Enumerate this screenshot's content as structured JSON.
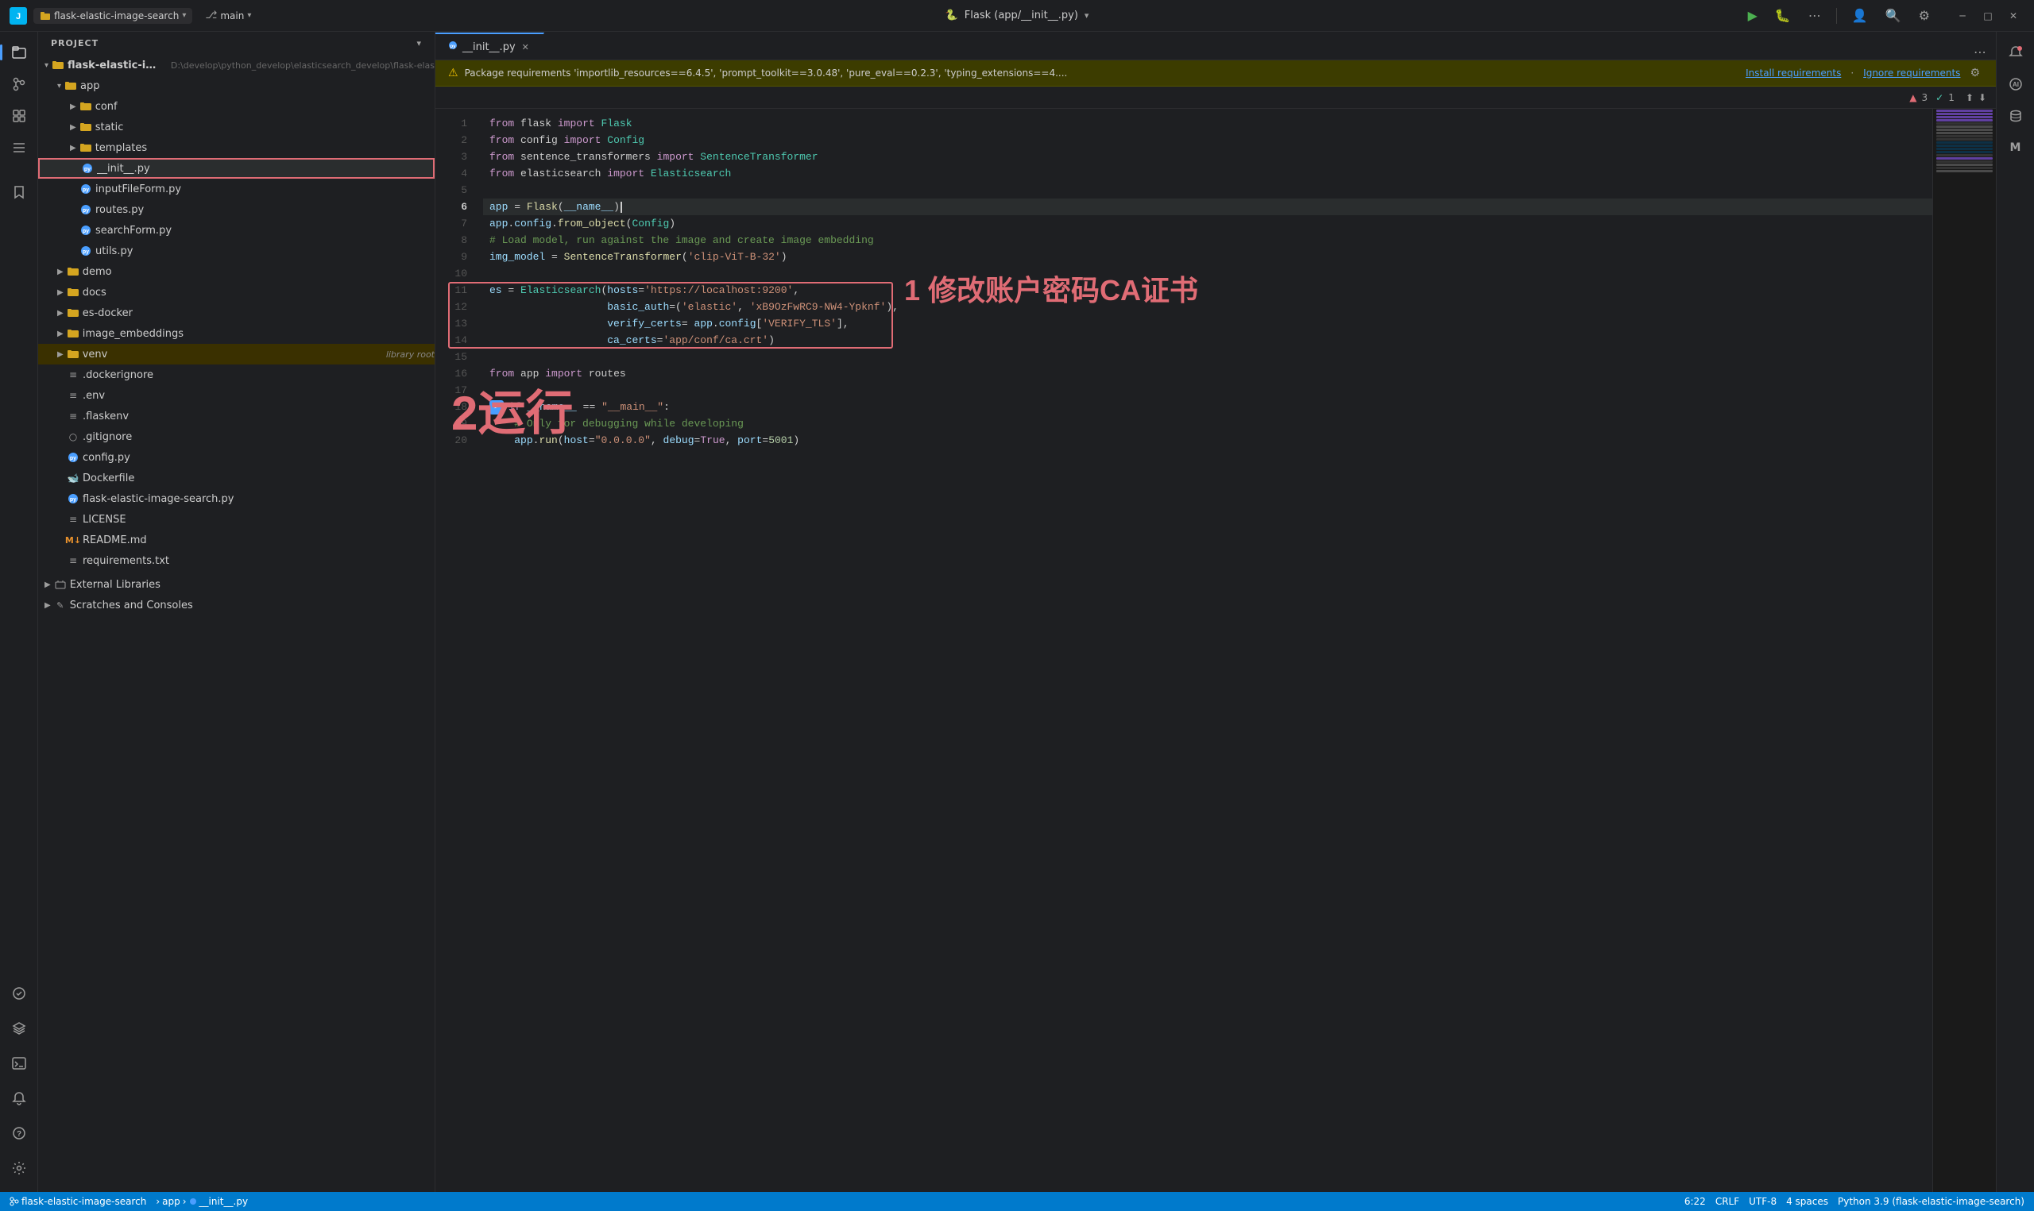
{
  "titleBar": {
    "appIcon": "J",
    "projectLabel": "flask-elastic-image-search",
    "projectDropdownIcon": "▾",
    "branchIcon": "⎇",
    "branchLabel": "main",
    "branchDropdownIcon": "▾",
    "tabTitle": "Flask (app/__init__.py)",
    "runIcon": "▶",
    "debugIcon": "🐛",
    "moreIcon": "⋯",
    "profileIcon": "👤",
    "searchIcon": "🔍",
    "settingsIcon": "⚙",
    "minimizeIcon": "─",
    "maximizeIcon": "□",
    "closeIcon": "✕"
  },
  "sidebar": {
    "title": "Project",
    "chevron": "▾",
    "tree": [
      {
        "id": "root",
        "label": "flask-elastic-image-search",
        "path": "D:\\develop\\python_develop\\elasticsearch_develop\\flask-elas",
        "indent": 0,
        "type": "folder",
        "expanded": true,
        "icon": "folder"
      },
      {
        "id": "app",
        "label": "app",
        "indent": 1,
        "type": "folder",
        "expanded": true,
        "icon": "folder"
      },
      {
        "id": "conf",
        "label": "conf",
        "indent": 2,
        "type": "folder",
        "expanded": false,
        "icon": "folder"
      },
      {
        "id": "static",
        "label": "static",
        "indent": 2,
        "type": "folder",
        "expanded": false,
        "icon": "folder"
      },
      {
        "id": "templates",
        "label": "templates",
        "indent": 2,
        "type": "folder",
        "expanded": false,
        "icon": "folder"
      },
      {
        "id": "__init__py",
        "label": "__init__.py",
        "indent": 2,
        "type": "file-py",
        "icon": "py",
        "selected": true
      },
      {
        "id": "inputFileForm",
        "label": "inputFileForm.py",
        "indent": 2,
        "type": "file-py",
        "icon": "py"
      },
      {
        "id": "routes",
        "label": "routes.py",
        "indent": 2,
        "type": "file-py",
        "icon": "py"
      },
      {
        "id": "searchForm",
        "label": "searchForm.py",
        "indent": 2,
        "type": "file-py",
        "icon": "py"
      },
      {
        "id": "utils",
        "label": "utils.py",
        "indent": 2,
        "type": "file-py",
        "icon": "py"
      },
      {
        "id": "demo",
        "label": "demo",
        "indent": 1,
        "type": "folder",
        "expanded": false,
        "icon": "folder"
      },
      {
        "id": "docs",
        "label": "docs",
        "indent": 1,
        "type": "folder",
        "expanded": false,
        "icon": "folder"
      },
      {
        "id": "es-docker",
        "label": "es-docker",
        "indent": 1,
        "type": "folder",
        "expanded": false,
        "icon": "folder"
      },
      {
        "id": "image_embeddings",
        "label": "image_embeddings",
        "indent": 1,
        "type": "folder",
        "expanded": false,
        "icon": "folder"
      },
      {
        "id": "venv",
        "label": "venv",
        "indent": 1,
        "type": "folder",
        "expanded": false,
        "icon": "folder",
        "tag": "library root"
      },
      {
        "id": "dockerignore",
        "label": ".dockerignore",
        "indent": 1,
        "type": "file",
        "icon": "env"
      },
      {
        "id": "env",
        "label": ".env",
        "indent": 1,
        "type": "file",
        "icon": "env"
      },
      {
        "id": "flaskenv",
        "label": ".flaskenv",
        "indent": 1,
        "type": "file",
        "icon": "env"
      },
      {
        "id": "gitignore",
        "label": ".gitignore",
        "indent": 1,
        "type": "file",
        "icon": "gitignore"
      },
      {
        "id": "config",
        "label": "config.py",
        "indent": 1,
        "type": "file-py",
        "icon": "config"
      },
      {
        "id": "dockerfile",
        "label": "Dockerfile",
        "indent": 1,
        "type": "file",
        "icon": "docker"
      },
      {
        "id": "flask-elastic",
        "label": "flask-elastic-image-search.py",
        "indent": 1,
        "type": "file-py",
        "icon": "py"
      },
      {
        "id": "license",
        "label": "LICENSE",
        "indent": 1,
        "type": "file",
        "icon": "license"
      },
      {
        "id": "readme",
        "label": "README.md",
        "indent": 1,
        "type": "file",
        "icon": "md"
      },
      {
        "id": "requirements",
        "label": "requirements.txt",
        "indent": 1,
        "type": "file",
        "icon": "txt"
      }
    ]
  },
  "externalLibraries": {
    "label": "External Libraries",
    "expanded": false
  },
  "scratchesConsoles": {
    "label": "Scratches and Consoles",
    "expanded": false
  },
  "tabs": [
    {
      "id": "init",
      "label": "__init__.py",
      "active": true,
      "icon": "py"
    }
  ],
  "notification": {
    "icon": "⚠",
    "text": "Package requirements 'importlib_resources==6.4.5', 'prompt_toolkit==3.0.48', 'pure_eval==0.2.3', 'typing_extensions==4....",
    "installLink": "Install requirements",
    "ignoreLink": "Ignore requirements",
    "settingsIcon": "⚙"
  },
  "editorGutter": {
    "gitBadge": "▲ 3  ✓ 1"
  },
  "code": {
    "lines": [
      {
        "num": 1,
        "content": "from flask import Flask"
      },
      {
        "num": 2,
        "content": "from config import Config"
      },
      {
        "num": 3,
        "content": "from sentence_transformers import SentenceTransformer"
      },
      {
        "num": 4,
        "content": "from elasticsearch import Elasticsearch"
      },
      {
        "num": 5,
        "content": ""
      },
      {
        "num": 6,
        "content": "app = Flask(__name__)"
      },
      {
        "num": 7,
        "content": "app.config.from_object(Config)"
      },
      {
        "num": 8,
        "content": "# Load model, run against the image and create image embedding"
      },
      {
        "num": 9,
        "content": "img_model = SentenceTransformer('clip-ViT-B-32')"
      },
      {
        "num": 10,
        "content": ""
      },
      {
        "num": 11,
        "content": "es = Elasticsearch(hosts='https://localhost:9200',"
      },
      {
        "num": 12,
        "content": "                   basic_auth=('elastic', 'xB9OzFwRC9-NW4-Ypknf'),"
      },
      {
        "num": 13,
        "content": "                   verify_certs= app.config['VERIFY_TLS'],"
      },
      {
        "num": 14,
        "content": "                   ca_certs='app/conf/ca.crt')"
      },
      {
        "num": 15,
        "content": ""
      },
      {
        "num": 16,
        "content": "from app import routes"
      },
      {
        "num": 17,
        "content": ""
      },
      {
        "num": 18,
        "content": "if __name__ == \"__main__\":"
      },
      {
        "num": 19,
        "content": "    # Only for debugging while developing"
      },
      {
        "num": 20,
        "content": "    app.run(host=\"0.0.0.0\", debug=True, port=5001)"
      }
    ]
  },
  "annotations": {
    "boxLabel": "1 修改账户密码CA证书",
    "runLabel": "2运行"
  },
  "statusBar": {
    "branch": "flask-elastic-image-search",
    "appSep": "›",
    "appPart": "app",
    "appSep2": "›",
    "filePart": "__init__.py",
    "lineCol": "6:22",
    "crlf": "CRLF",
    "encoding": "UTF-8",
    "indent": "4 spaces",
    "language": "Python 3.9 (flask-elastic-image-search)"
  },
  "activityBar": {
    "items": [
      {
        "id": "project",
        "icon": "📁",
        "tooltip": "Project"
      },
      {
        "id": "vcs",
        "icon": "✓",
        "tooltip": "Version Control"
      },
      {
        "id": "plugins",
        "icon": "🔌",
        "tooltip": "Plugins"
      },
      {
        "id": "structure",
        "icon": "☰",
        "tooltip": "Structure"
      },
      {
        "id": "bookmarks",
        "icon": "🔖",
        "tooltip": "Bookmarks"
      }
    ],
    "bottom": [
      {
        "id": "services",
        "icon": "⚡",
        "tooltip": "Services"
      },
      {
        "id": "problems",
        "icon": "⬡",
        "tooltip": "Problems"
      },
      {
        "id": "terminal",
        "icon": "⬚",
        "tooltip": "Terminal"
      },
      {
        "id": "notifications",
        "icon": "🔔",
        "tooltip": "Notifications"
      },
      {
        "id": "help",
        "icon": "?",
        "tooltip": "Help"
      },
      {
        "id": "settings",
        "icon": "⚙",
        "tooltip": "Settings"
      }
    ]
  }
}
